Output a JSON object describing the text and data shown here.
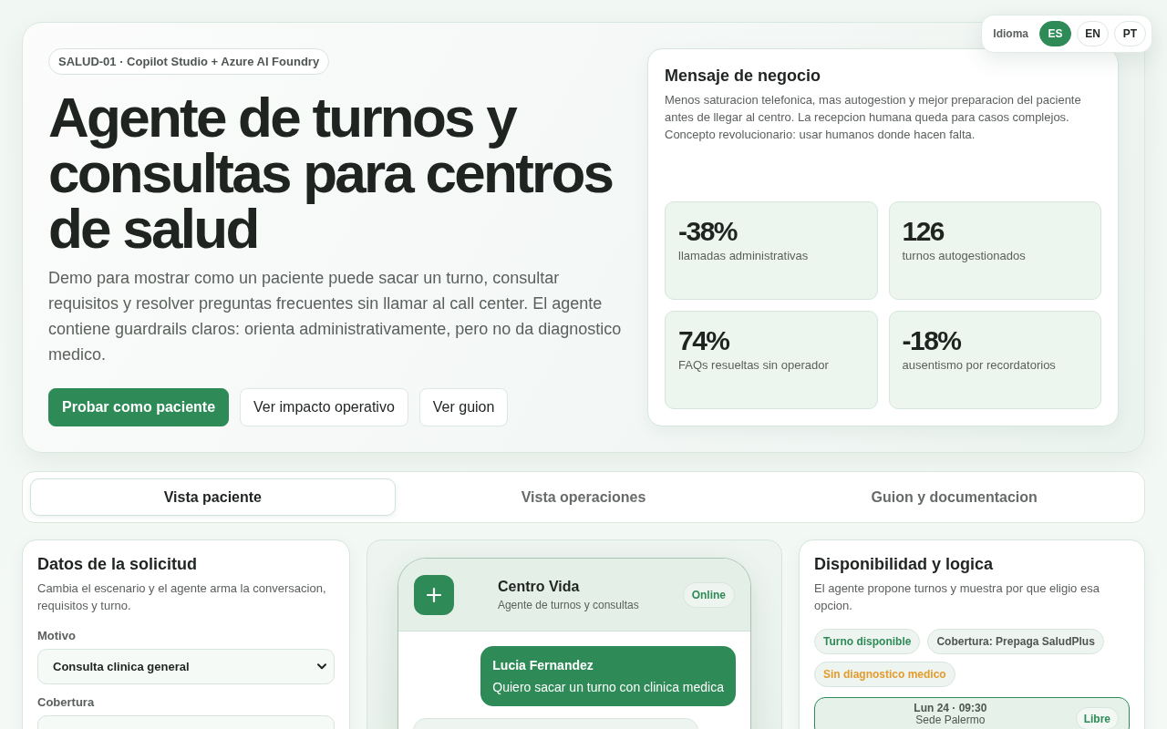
{
  "language_switcher": {
    "label": "Idioma",
    "options": [
      {
        "label": "ES",
        "selected": true
      },
      {
        "label": "EN",
        "selected": false
      },
      {
        "label": "PT",
        "selected": false
      }
    ]
  },
  "hero": {
    "badge": "SALUD-01 · Copilot Studio + Azure AI Foundry",
    "title": "Agente de turnos y consultas para centros de salud",
    "description": "Demo para mostrar como un paciente puede sacar un turno, consultar requisitos y resolver preguntas frecuentes sin llamar al call center. El agente contiene guardrails claros: orienta administrativamente, pero no da diagnostico medico.",
    "buttons": [
      {
        "label": "Probar como paciente",
        "kind": "primary"
      },
      {
        "label": "Ver impacto operativo",
        "kind": "secondary"
      },
      {
        "label": "Ver guion",
        "kind": "secondary"
      }
    ]
  },
  "business_message": {
    "title": "Mensaje de negocio",
    "text": "Menos saturacion telefonica, mas autogestion y mejor preparacion del paciente antes de llegar al centro. La recepcion humana queda para casos complejos. Concepto revolucionario: usar humanos donde hacen falta.",
    "stats": [
      {
        "value": "-38%",
        "label": "llamadas administrativas"
      },
      {
        "value": "126",
        "label": "turnos autogestionados"
      },
      {
        "value": "74%",
        "label": "FAQs resueltas sin operador"
      },
      {
        "value": "-18%",
        "label": "ausentismo por recordatorios"
      }
    ]
  },
  "view_tabs": [
    {
      "label": "Vista paciente",
      "selected": true
    },
    {
      "label": "Vista operaciones",
      "selected": false
    },
    {
      "label": "Guion y documentacion",
      "selected": false
    }
  ],
  "request_panel": {
    "title": "Datos de la solicitud",
    "description": "Cambia el escenario y el agente arma la conversacion, requisitos y turno.",
    "fields": [
      {
        "label": "Motivo",
        "value": "Consulta clinica general"
      },
      {
        "label": "Cobertura"
      }
    ]
  },
  "chat_preview": {
    "title": "Centro Vida",
    "subtitle": "Agente de turnos y consultas",
    "status": "Online",
    "messages": [
      {
        "kind": "user",
        "author": "Lucia Fernandez",
        "text": "Quiero sacar un turno con clinica medica"
      },
      {
        "kind": "agent"
      }
    ]
  },
  "availability_panel": {
    "title": "Disponibilidad y logica",
    "description": "El agente propone turnos y muestra por que eligio esa opcion.",
    "chips": [
      {
        "label": "Turno disponible",
        "color": "#2e8b57"
      },
      {
        "label": "Cobertura: Prepaga SaludPlus",
        "color": "#4f5652"
      },
      {
        "label": "Sin diagnostico medico",
        "color": "#e39b2d"
      }
    ],
    "slots": [
      {
        "time": "Lun 24 · 09:30",
        "location": "Sede Palermo",
        "status": "Libre",
        "selected": true
      }
    ]
  }
}
